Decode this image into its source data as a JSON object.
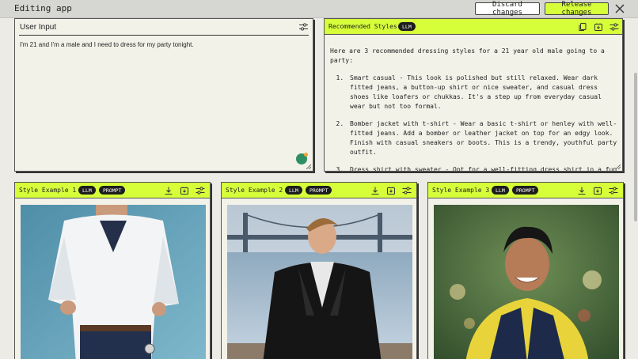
{
  "app": {
    "title": "Editing app",
    "discard_label": "Discard changes",
    "release_label": "Release changes",
    "accent": "#d6ff3a"
  },
  "user_input": {
    "title": "User Input",
    "text": "I'm 21 and I'm a male and I need to dress for my party tonight."
  },
  "recommended": {
    "title": "Recommended Styles",
    "badge": "LLM",
    "intro": "Here are 3 recommended dressing styles for a 21 year old male going to a party:",
    "items": [
      "Smart casual - This look is polished but still relaxed. Wear dark fitted jeans, a button-up shirt or nice sweater, and casual dress shoes like loafers or chukkas. It's a step up from everyday casual wear but not too formal.",
      "Bomber jacket with t-shirt - Wear a basic t-shirt or henley with well-fitted jeans. Add a bomber or leather jacket on top for an edgy look. Finish with casual sneakers or boots. This is a trendy, youthful party outfit.",
      "Dress shirt with sweater - Opt for a well-fitting dress shirt in a fun"
    ]
  },
  "cards": [
    {
      "title": "Style Example 1",
      "badge_llm": "LLM",
      "badge_prompt": "PROMPT"
    },
    {
      "title": "Style Example 2",
      "badge_llm": "LLM",
      "badge_prompt": "PROMPT"
    },
    {
      "title": "Style Example 3",
      "badge_llm": "LLM",
      "badge_prompt": "PROMPT"
    }
  ],
  "icons": [
    "close-icon",
    "settings-sliders-icon",
    "copy-icon",
    "save-icon",
    "download-icon",
    "assistant-badge-icon",
    "resize-grip-icon"
  ]
}
